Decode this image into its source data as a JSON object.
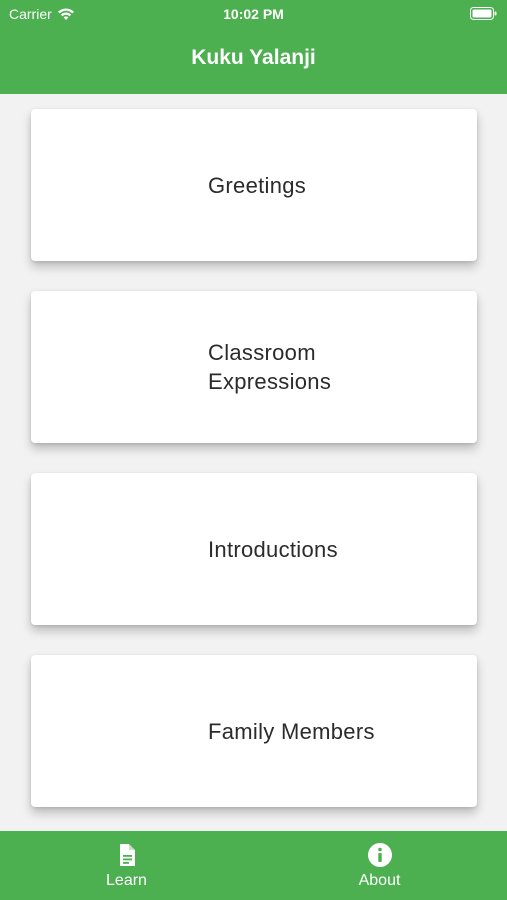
{
  "status_bar": {
    "carrier": "Carrier",
    "time": "10:02 PM"
  },
  "header": {
    "title": "Kuku Yalanji"
  },
  "categories": [
    {
      "label": "Greetings"
    },
    {
      "label": "Classroom\nExpressions"
    },
    {
      "label": "Introductions"
    },
    {
      "label": "Family Members"
    }
  ],
  "tabs": [
    {
      "label": "Learn",
      "icon": "document-icon",
      "active": true
    },
    {
      "label": "About",
      "icon": "info-icon",
      "active": false
    }
  ],
  "colors": {
    "primary": "#4caf50",
    "card_background": "#ffffff",
    "page_background": "#f2f2f2",
    "card_text": "#2b2b2b"
  }
}
